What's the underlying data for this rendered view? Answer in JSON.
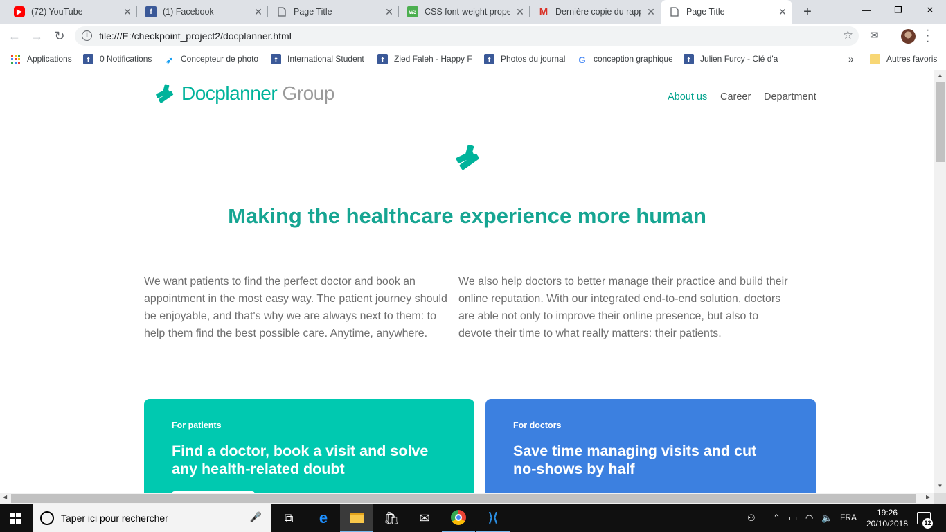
{
  "tabs": [
    {
      "title": "(72) YouTube",
      "icon": "youtube-icon"
    },
    {
      "title": "(1) Facebook",
      "icon": "facebook-icon"
    },
    {
      "title": "Page Title",
      "icon": "page-icon"
    },
    {
      "title": "CSS font-weight proper",
      "icon": "w3schools-icon"
    },
    {
      "title": "Dernière copie du rapp",
      "icon": "gmail-icon"
    },
    {
      "title": "Page Title",
      "icon": "page-icon",
      "active": true
    }
  ],
  "tab_close_glyph": "✕",
  "new_tab_glyph": "+",
  "window": {
    "minimize": "—",
    "maximize": "❐",
    "close": "✕"
  },
  "address_bar": {
    "url": "file:///E:/checkpoint_project2/docplanner.html"
  },
  "bookmarks": [
    {
      "label": "Applications",
      "icon": "apps-grid-icon"
    },
    {
      "label": "0 Notifications",
      "icon": "facebook-icon"
    },
    {
      "label": "Concepteur de photo",
      "icon": "bird-icon"
    },
    {
      "label": "International Student",
      "icon": "facebook-icon"
    },
    {
      "label": "Zied Faleh - Happy Fa",
      "icon": "facebook-icon"
    },
    {
      "label": "Photos du journal",
      "icon": "facebook-icon"
    },
    {
      "label": "conception graphique",
      "icon": "google-icon"
    },
    {
      "label": "Julien Furcy - Clé d'ac",
      "icon": "facebook-icon"
    }
  ],
  "bookmarks_overflow": "»",
  "other_bookmarks": "Autres favoris",
  "site": {
    "brand_primary": "Docplanner",
    "brand_secondary": "Group",
    "nav": [
      "About us",
      "Career",
      "Department"
    ],
    "hero_title": "Making the healthcare experience more human",
    "para_left": "We want patients to find the perfect doctor and book an appointment in the most easy way. The patient journey should be enjoyable, and that's why we are always next to them: to help them find the best possible care. Anytime, anywhere.",
    "para_right": "We also help doctors to better manage their practice and build their online reputation. With our integrated end-to-end solution, doctors are able not only to improve their online presence, but also to devote their time to what really matters: their patients.",
    "cards": [
      {
        "kicker": "For patients",
        "heading": "Find a doctor, book a visit and solve any health-related doubt",
        "color": "#00c9b0"
      },
      {
        "kicker": "For doctors",
        "heading": "Save time managing visits and cut no-shows by half",
        "color": "#3c80e0"
      }
    ],
    "accent_color": "#00b39b"
  },
  "taskbar": {
    "search_placeholder": "Taper ici pour rechercher",
    "language": "FRA",
    "time": "19:26",
    "date": "20/10/2018",
    "notification_count": "12"
  }
}
